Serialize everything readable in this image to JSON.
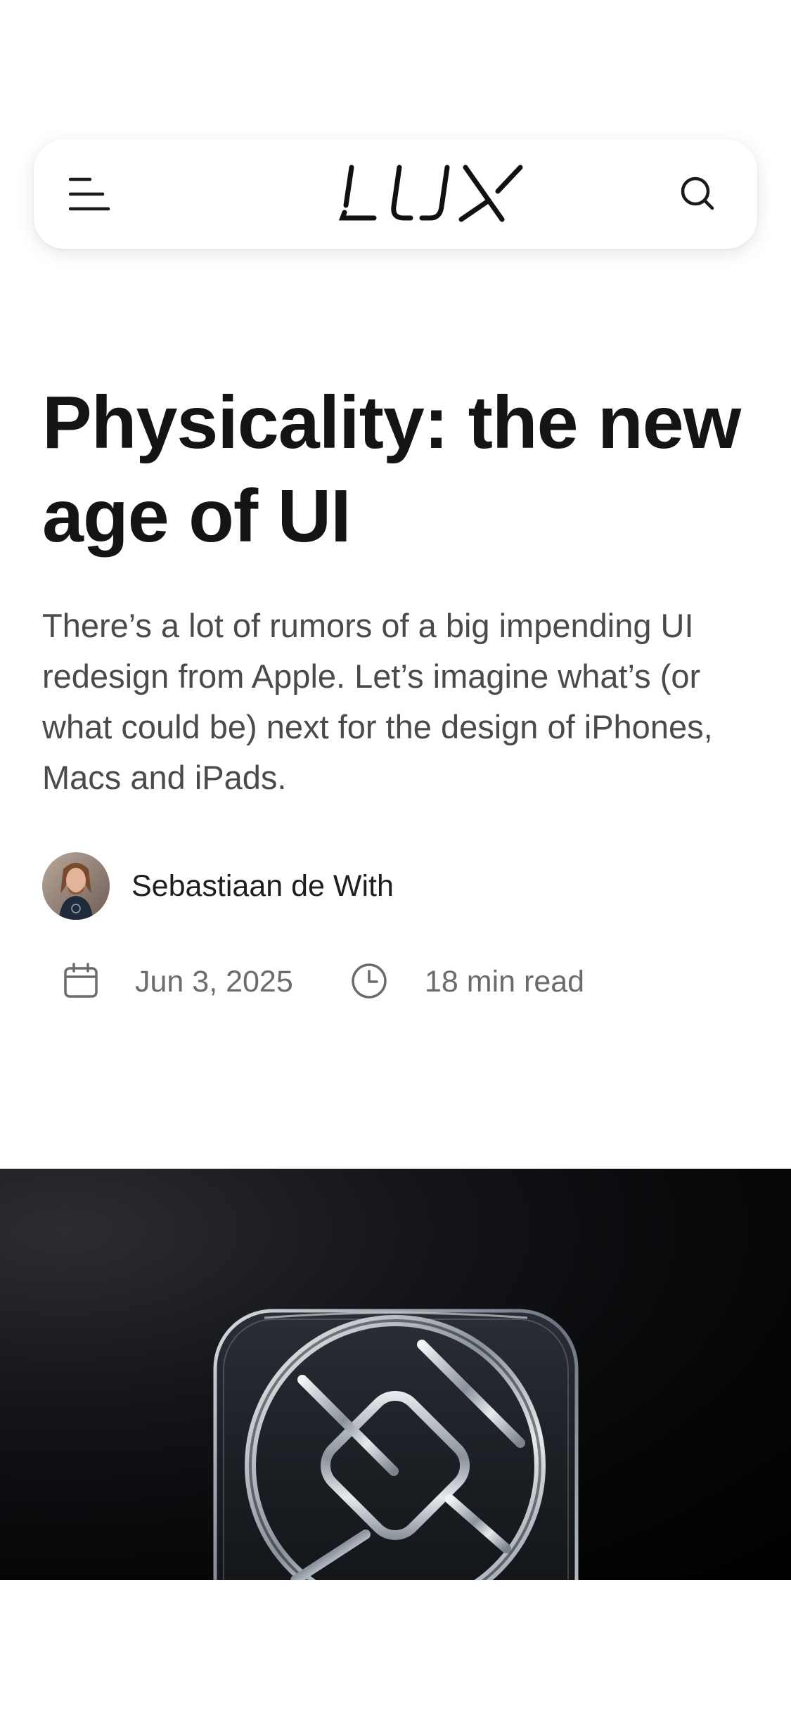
{
  "header": {
    "logo_text": "LUX",
    "menu_icon": "hamburger-menu-icon",
    "search_icon": "search-icon"
  },
  "article": {
    "title": "Physicality: the new age of UI",
    "subtitle": "There’s a lot of rumors of a big impending UI redesign from Apple. Let’s imagine what’s (or what could be) next for the design of iPhones, Macs and iPads.",
    "author": {
      "name": "Sebastiaan de With"
    },
    "meta": {
      "date": "Jun 3, 2025",
      "date_icon": "calendar-icon",
      "read_time": "18 min read",
      "read_time_icon": "clock-icon"
    },
    "hero_image": "glass-app-icon-render"
  },
  "colors": {
    "background": "#ffffff",
    "title": "#141414",
    "body_text": "#4a4a4a",
    "meta_text": "#6b6b6b",
    "hero_background": "#050607"
  }
}
